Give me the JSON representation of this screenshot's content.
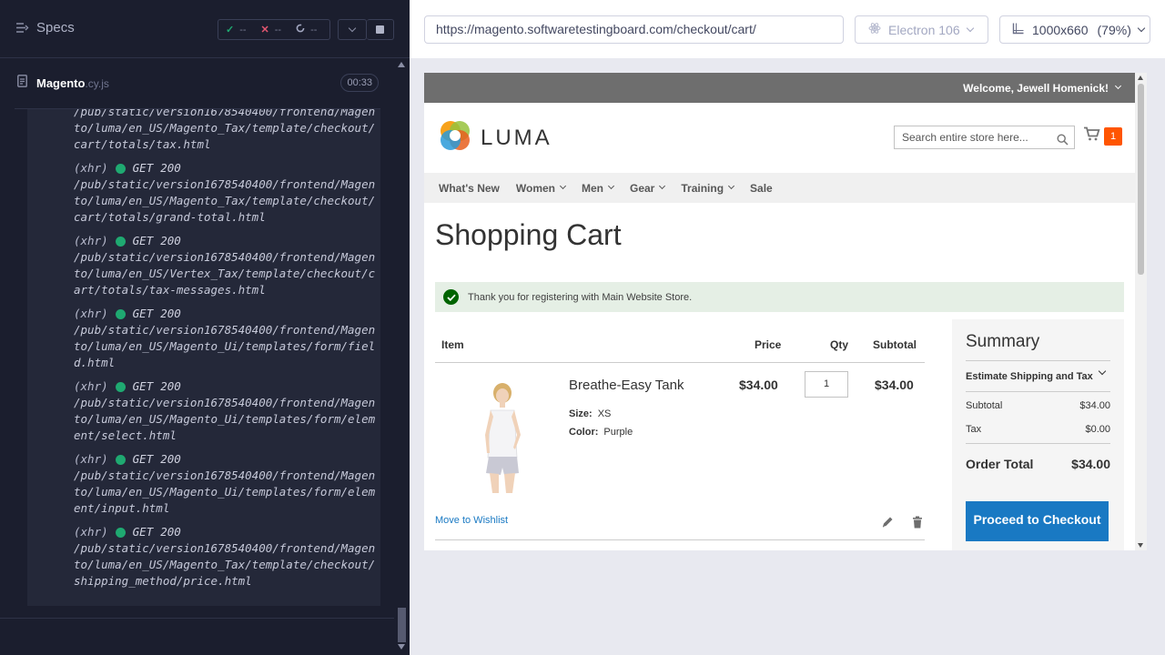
{
  "runner": {
    "specs_label": "Specs",
    "stats": {
      "passed": "--",
      "failed": "--",
      "pending": "--"
    },
    "spec": {
      "name": "Magento",
      "ext": ".cy.js",
      "time": "00:33"
    },
    "log": [
      {
        "type": "",
        "method": "",
        "status": "",
        "url": "/pub/static/version1678540400/frontend/Magento/luma/en_US/Magento_Tax/template/checkout/cart/totals/tax.html"
      },
      {
        "type": "(xhr)",
        "method": "GET",
        "status": "200",
        "url": "/pub/static/version1678540400/frontend/Magento/luma/en_US/Magento_Tax/template/checkout/cart/totals/grand-total.html"
      },
      {
        "type": "(xhr)",
        "method": "GET",
        "status": "200",
        "url": "/pub/static/version1678540400/frontend/Magento/luma/en_US/Vertex_Tax/template/checkout/cart/totals/tax-messages.html"
      },
      {
        "type": "(xhr)",
        "method": "GET",
        "status": "200",
        "url": "/pub/static/version1678540400/frontend/Magento/luma/en_US/Magento_Ui/templates/form/field.html"
      },
      {
        "type": "(xhr)",
        "method": "GET",
        "status": "200",
        "url": "/pub/static/version1678540400/frontend/Magento/luma/en_US/Magento_Ui/templates/form/element/select.html"
      },
      {
        "type": "(xhr)",
        "method": "GET",
        "status": "200",
        "url": "/pub/static/version1678540400/frontend/Magento/luma/en_US/Magento_Ui/templates/form/element/input.html"
      },
      {
        "type": "(xhr)",
        "method": "GET",
        "status": "200",
        "url": "/pub/static/version1678540400/frontend/Magento/luma/en_US/Magento_Tax/template/checkout/shipping_method/price.html"
      }
    ]
  },
  "aut": {
    "url": "https://magento.softwaretestingboard.com/checkout/cart/",
    "browser": "Electron 106",
    "viewport": "1000x660",
    "zoom": "(79%)"
  },
  "site": {
    "welcome": "Welcome, Jewell Homenick!",
    "logo": "LUMA",
    "search_placeholder": "Search entire store here...",
    "cart_count": "1",
    "nav": [
      "What's New",
      "Women",
      "Men",
      "Gear",
      "Training",
      "Sale"
    ],
    "page_title": "Shopping Cart",
    "message": "Thank you for registering with Main Website Store.",
    "table_headers": {
      "item": "Item",
      "price": "Price",
      "qty": "Qty",
      "subtotal": "Subtotal"
    },
    "item": {
      "name": "Breathe-Easy Tank",
      "size_label": "Size:",
      "size": "XS",
      "color_label": "Color:",
      "color": "Purple",
      "price": "$34.00",
      "qty": "1",
      "subtotal": "$34.00"
    },
    "wishlist": "Move to Wishlist",
    "summary": {
      "title": "Summary",
      "estimate": "Estimate Shipping and Tax",
      "subtotal_label": "Subtotal",
      "subtotal": "$34.00",
      "tax_label": "Tax",
      "tax": "$0.00",
      "total_label": "Order Total",
      "total": "$34.00",
      "proceed": "Proceed to Checkout"
    }
  },
  "colors": {
    "success": "#1fa971",
    "fail": "#e45770",
    "accent": "#1979c3",
    "cart_badge": "#ff5501"
  }
}
